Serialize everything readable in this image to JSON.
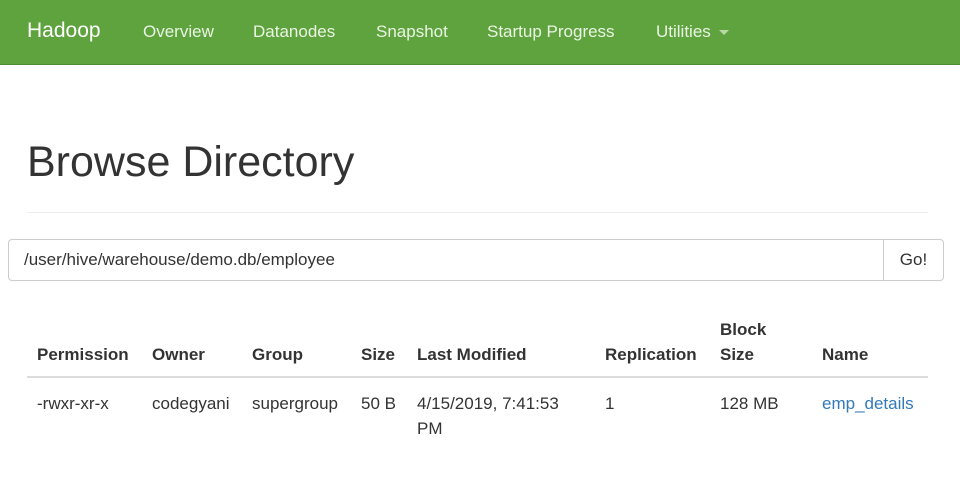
{
  "navbar": {
    "brand": "Hadoop",
    "items": [
      {
        "label": "Overview"
      },
      {
        "label": "Datanodes"
      },
      {
        "label": "Snapshot"
      },
      {
        "label": "Startup Progress"
      },
      {
        "label": "Utilities"
      }
    ],
    "dropdown_icon": "caret-down-icon"
  },
  "main": {
    "title": "Browse Directory",
    "path_value": "/user/hive/warehouse/demo.db/employee",
    "go_label": "Go!"
  },
  "table": {
    "columns": [
      "Permission",
      "Owner",
      "Group",
      "Size",
      "Last Modified",
      "Replication",
      "Block",
      "Size",
      "Name"
    ],
    "rows": [
      {
        "permission": "-rwxr-xr-x",
        "owner": "codegyani",
        "group": "supergroup",
        "size": "50 B",
        "last_modified_line1": "4/15/2019, 7:41:53",
        "last_modified_line2": "PM",
        "replication": "1",
        "block_size": "128 MB",
        "name": "emp_details"
      }
    ]
  },
  "colors": {
    "navbar": "#5fa33e",
    "link": "#337ab7"
  }
}
